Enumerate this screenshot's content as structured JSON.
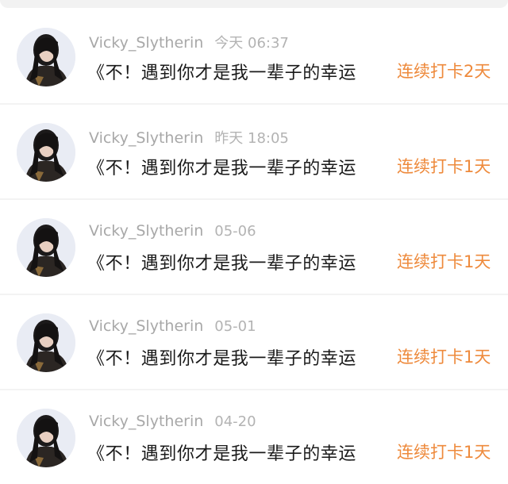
{
  "feed": {
    "items": [
      {
        "username": "Vicky_Slytherin",
        "time": "今天 06:37",
        "title": "《不！遇到你才是我一辈子的幸运",
        "badge": "连续打卡2天"
      },
      {
        "username": "Vicky_Slytherin",
        "time": "昨天 18:05",
        "title": "《不！遇到你才是我一辈子的幸运",
        "badge": "连续打卡1天"
      },
      {
        "username": "Vicky_Slytherin",
        "time": "05-06",
        "title": "《不！遇到你才是我一辈子的幸运",
        "badge": "连续打卡1天"
      },
      {
        "username": "Vicky_Slytherin",
        "time": "05-01",
        "title": "《不！遇到你才是我一辈子的幸运",
        "badge": "连续打卡1天"
      },
      {
        "username": "Vicky_Slytherin",
        "time": "04-20",
        "title": "《不！遇到你才是我一辈子的幸运",
        "badge": "连续打卡1天"
      }
    ]
  },
  "colors": {
    "badge": "#ee8a3c",
    "username": "#a8a8a8",
    "title": "#1a1a1a",
    "divider": "#f3f3f3"
  },
  "icons": {
    "avatar": "user-avatar-photo"
  }
}
